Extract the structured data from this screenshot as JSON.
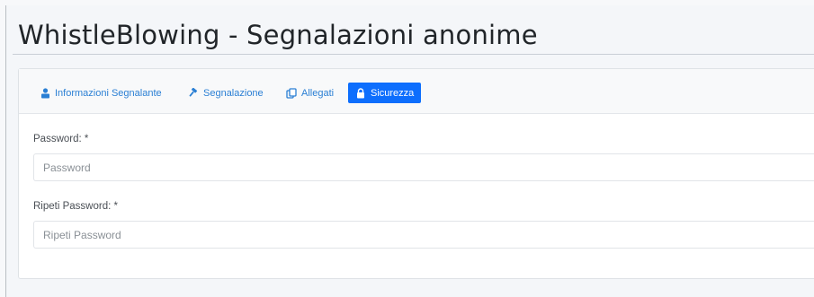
{
  "page": {
    "title": "WhistleBlowing - Segnalazioni anonime"
  },
  "tabs": [
    {
      "label": "Informazioni Segnalante",
      "icon": "user-lock-icon",
      "active": false
    },
    {
      "label": "Segnalazione",
      "icon": "gavel-icon",
      "active": false
    },
    {
      "label": "Allegati",
      "icon": "copy-icon",
      "active": false
    },
    {
      "label": "Sicurezza",
      "icon": "lock-icon",
      "active": true
    }
  ],
  "form": {
    "password": {
      "label": "Password: *",
      "placeholder": "Password",
      "value": ""
    },
    "repeat_password": {
      "label": "Ripeti Password: *",
      "placeholder": "Ripeti Password",
      "value": ""
    }
  },
  "colors": {
    "accent": "#0d6efd",
    "link": "#2a7fd4",
    "background": "#f4f6f9"
  }
}
